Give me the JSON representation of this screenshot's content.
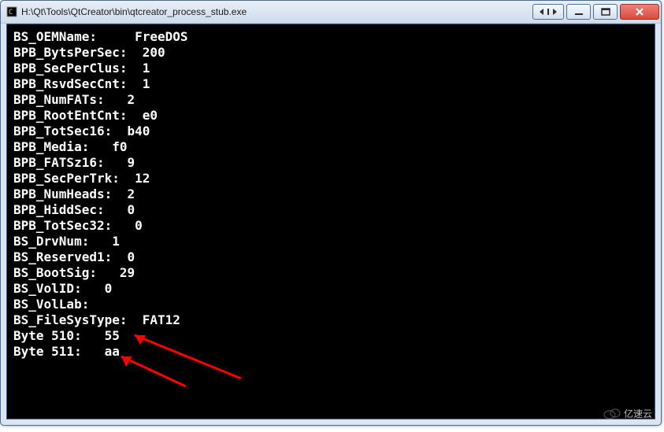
{
  "window": {
    "title": "H:\\Qt\\Tools\\QtCreator\\bin\\qtcreator_process_stub.exe"
  },
  "lines": [
    {
      "label": "BS_OEMName:",
      "pad": 5,
      "value": "FreeDOS"
    },
    {
      "label": "BPB_BytsPerSec:",
      "pad": 2,
      "value": "200"
    },
    {
      "label": "BPB_SecPerClus:",
      "pad": 2,
      "value": "1"
    },
    {
      "label": "BPB_RsvdSecCnt:",
      "pad": 2,
      "value": "1"
    },
    {
      "label": "BPB_NumFATs:",
      "pad": 3,
      "value": "2"
    },
    {
      "label": "BPB_RootEntCnt:",
      "pad": 2,
      "value": "e0"
    },
    {
      "label": "BPB_TotSec16:",
      "pad": 2,
      "value": "b40"
    },
    {
      "label": "BPB_Media:",
      "pad": 3,
      "value": "f0"
    },
    {
      "label": "BPB_FATSz16:",
      "pad": 3,
      "value": "9"
    },
    {
      "label": "BPB_SecPerTrk:",
      "pad": 2,
      "value": "12"
    },
    {
      "label": "BPB_NumHeads:",
      "pad": 2,
      "value": "2"
    },
    {
      "label": "BPB_HiddSec:",
      "pad": 3,
      "value": "0"
    },
    {
      "label": "BPB_TotSec32:",
      "pad": 3,
      "value": "0"
    },
    {
      "label": "BS_DrvNum:",
      "pad": 3,
      "value": "1"
    },
    {
      "label": "BS_Reserved1:",
      "pad": 2,
      "value": "0"
    },
    {
      "label": "BS_BootSig:",
      "pad": 3,
      "value": "29"
    },
    {
      "label": "BS_VolID:",
      "pad": 3,
      "value": "0"
    },
    {
      "label": "BS_VolLab:",
      "pad": 0,
      "value": ""
    },
    {
      "label": "BS_FileSysType:",
      "pad": 2,
      "value": "FAT12"
    },
    {
      "label": "Byte 510:",
      "pad": 3,
      "value": "55"
    },
    {
      "label": "Byte 511:",
      "pad": 3,
      "value": "aa"
    }
  ],
  "watermark": "亿速云"
}
